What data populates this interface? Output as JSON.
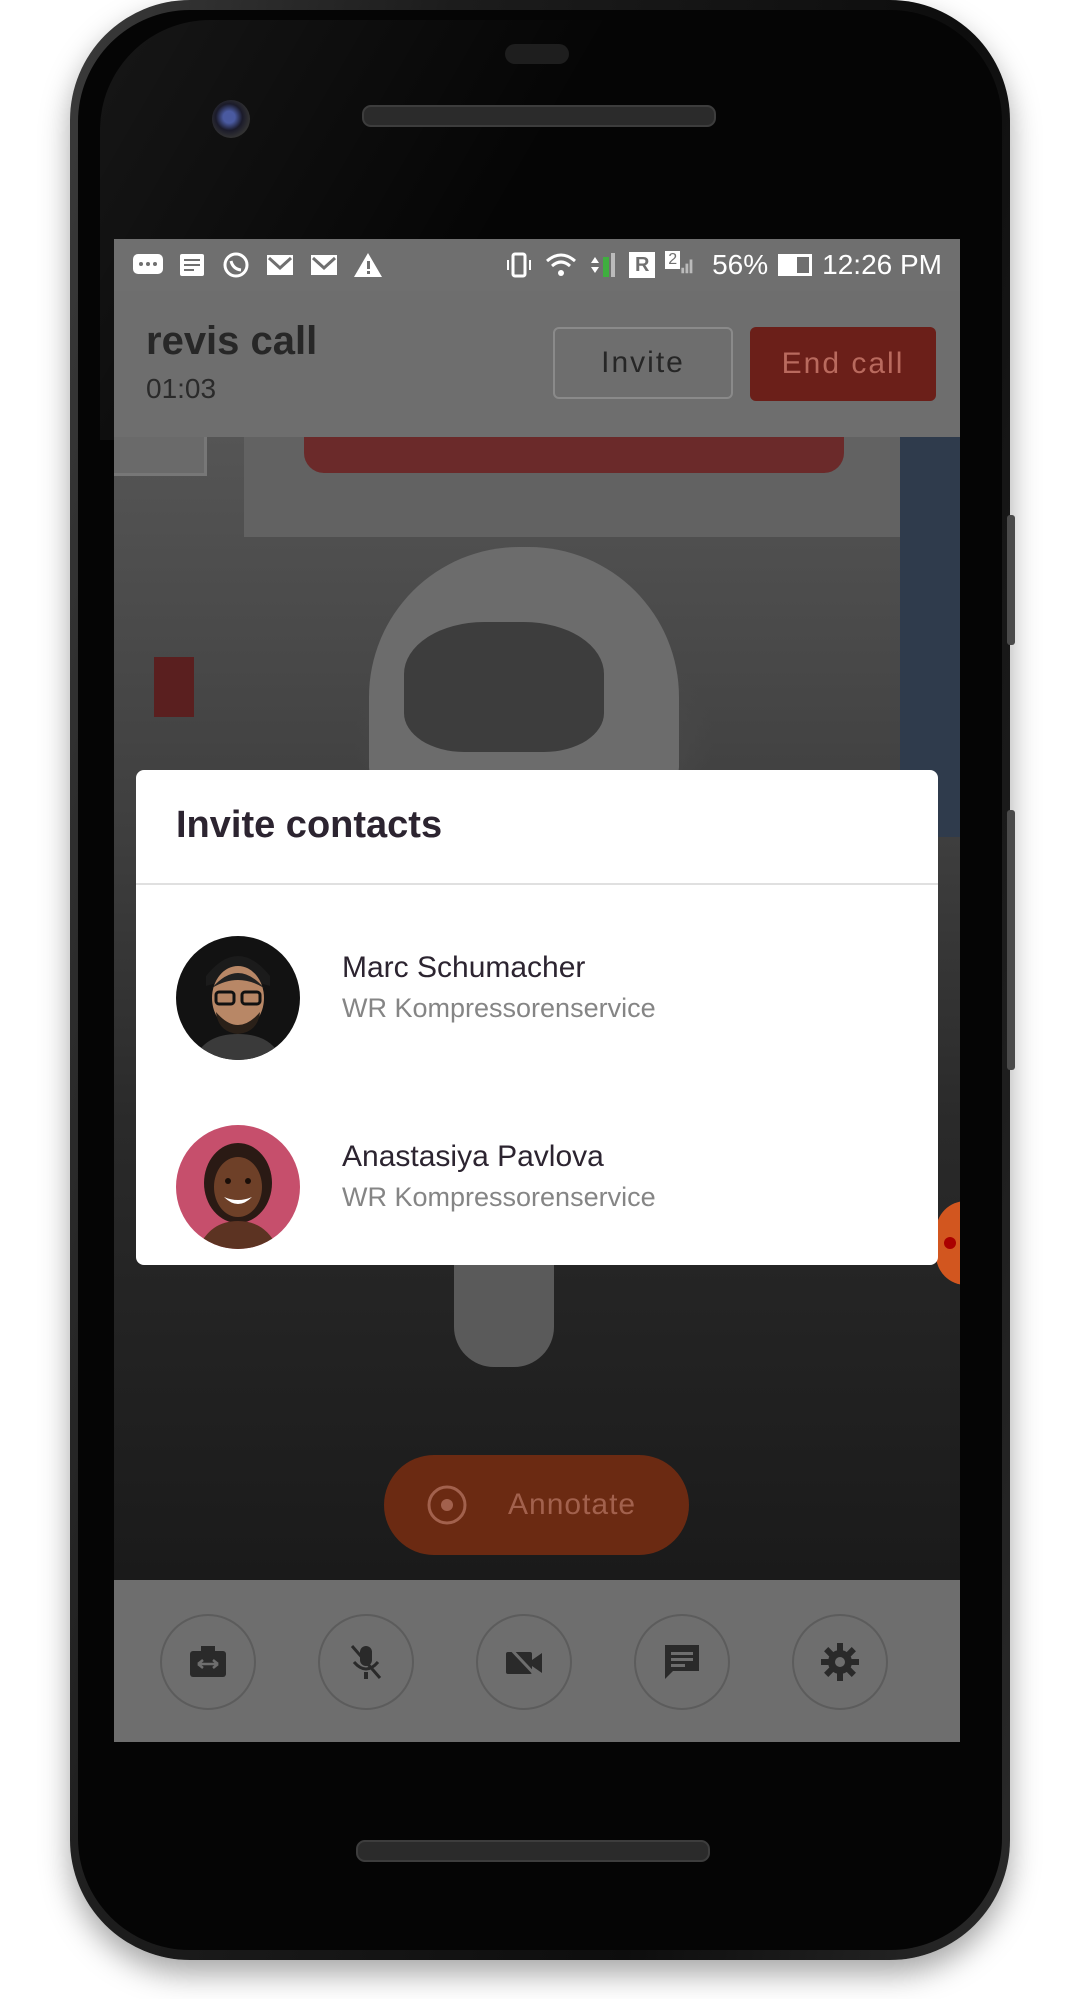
{
  "status_bar": {
    "notification_icons": [
      "messages-icon",
      "news-icon",
      "whatsapp-icon",
      "mail-icon",
      "mail-icon",
      "warning-icon"
    ],
    "roaming_badge": "R",
    "sim_badge": "2",
    "battery": "56%",
    "time": "12:26 PM"
  },
  "header": {
    "title": "revis call",
    "timer": "01:03",
    "invite_label": "Invite",
    "end_call_label": "End call"
  },
  "dialog": {
    "title": "Invite contacts",
    "contacts": [
      {
        "name": "Marc Schumacher",
        "company": "WR Kompressorenservice"
      },
      {
        "name": "Anastasiya Pavlova",
        "company": "WR Kompressorenservice"
      }
    ]
  },
  "annotate": {
    "label": "Annotate"
  },
  "toolbar": {
    "items": [
      "switch-camera-icon",
      "mic-off-icon",
      "video-off-icon",
      "chat-icon",
      "settings-icon"
    ]
  },
  "colors": {
    "end_call": "#6b1f19",
    "annotate": "#6b2a12",
    "dim_header": "#6e6e6e",
    "dialog_bg": "#ffffff",
    "title_text": "#2c2430"
  }
}
